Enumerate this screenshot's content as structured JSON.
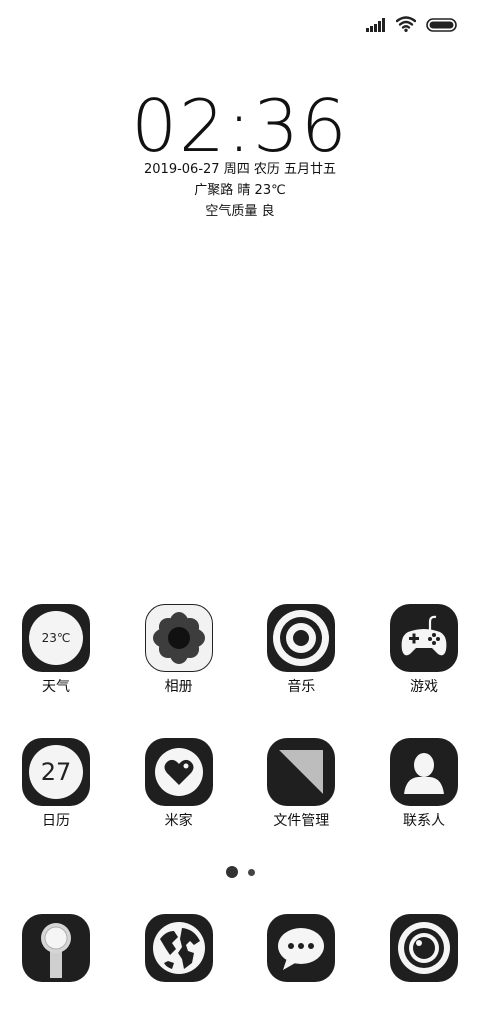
{
  "status_bar": {
    "icons": [
      "signal-icon",
      "wifi-icon",
      "battery-icon"
    ]
  },
  "clock": {
    "time": "02:36",
    "date_line": "2019-06-27 周四 农历 五月廿五",
    "weather_line": "广聚路 晴 23℃",
    "air_line": "空气质量 良"
  },
  "home": {
    "row1": [
      {
        "label": "天气",
        "icon": "weather-icon",
        "icon_text": "23℃"
      },
      {
        "label": "相册",
        "icon": "gallery-icon"
      },
      {
        "label": "音乐",
        "icon": "music-icon"
      },
      {
        "label": "游戏",
        "icon": "gamepad-icon"
      }
    ],
    "row2": [
      {
        "label": "日历",
        "icon": "calendar-icon",
        "icon_text": "27"
      },
      {
        "label": "米家",
        "icon": "mijia-heart-icon"
      },
      {
        "label": "文件管理",
        "icon": "file-manager-icon"
      },
      {
        "label": "联系人",
        "icon": "contacts-icon"
      }
    ]
  },
  "pager": {
    "pages": 2,
    "active": 0
  },
  "dock": [
    "phone-icon",
    "browser-globe-icon",
    "messages-icon",
    "camera-icon"
  ],
  "colors": {
    "icon_bg": "#1f1f1f",
    "background": "#ffffff"
  }
}
